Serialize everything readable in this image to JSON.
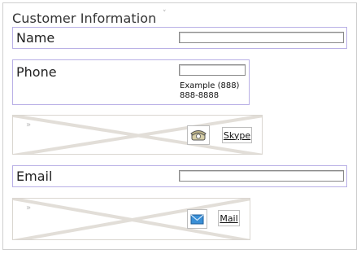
{
  "form": {
    "title": "Customer Information"
  },
  "name": {
    "label": "Name",
    "value": ""
  },
  "phone": {
    "label": "Phone",
    "value": "",
    "hint_line1": "Example (888)",
    "hint_line2": "888-8888",
    "skype_label": "Skype"
  },
  "email": {
    "label": "Email",
    "value": "",
    "mail_label": "Mail"
  },
  "icons": {
    "collapse": "chevron-down-icon",
    "phone": "telephone-icon",
    "mail": "envelope-icon",
    "expand": "double-chevron-right-icon"
  },
  "colors": {
    "row_border": "#b9b0e6",
    "placeholder_border": "#dad6d0",
    "envelope": "#3a8fd6"
  }
}
